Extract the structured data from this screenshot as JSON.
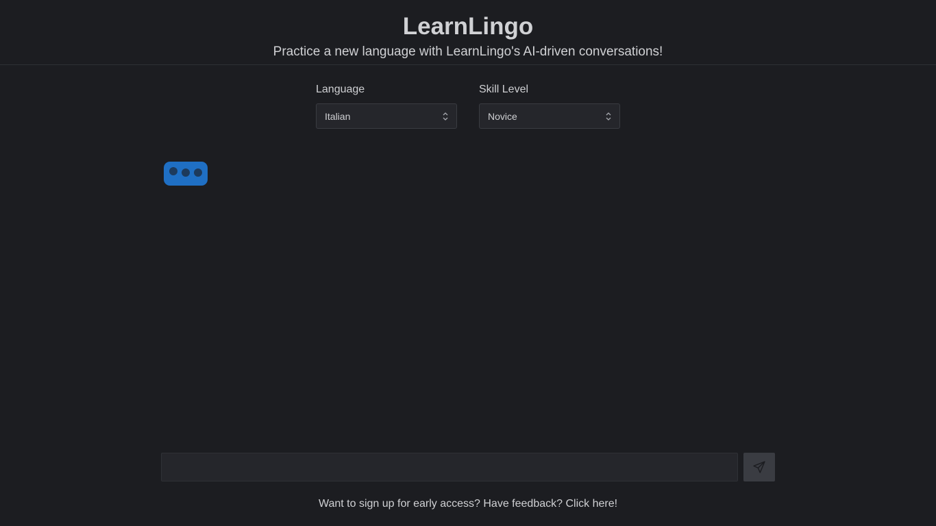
{
  "header": {
    "title": "LearnLingo",
    "subtitle": "Practice a new language with LearnLingo's AI-driven conversations!"
  },
  "settings": {
    "language": {
      "label": "Language",
      "selected": "Italian"
    },
    "skill_level": {
      "label": "Skill Level",
      "selected": "Novice"
    }
  },
  "chat": {
    "typing_indicator_icon": "typing-dots-icon",
    "input_value": "",
    "send_icon": "paper-plane-icon"
  },
  "footer": {
    "link_text": "Want to sign up for early access? Have feedback? Click here!"
  },
  "colors": {
    "background": "#1c1d21",
    "bubble": "#1f6fc4",
    "send_button": "#3a3c42"
  }
}
